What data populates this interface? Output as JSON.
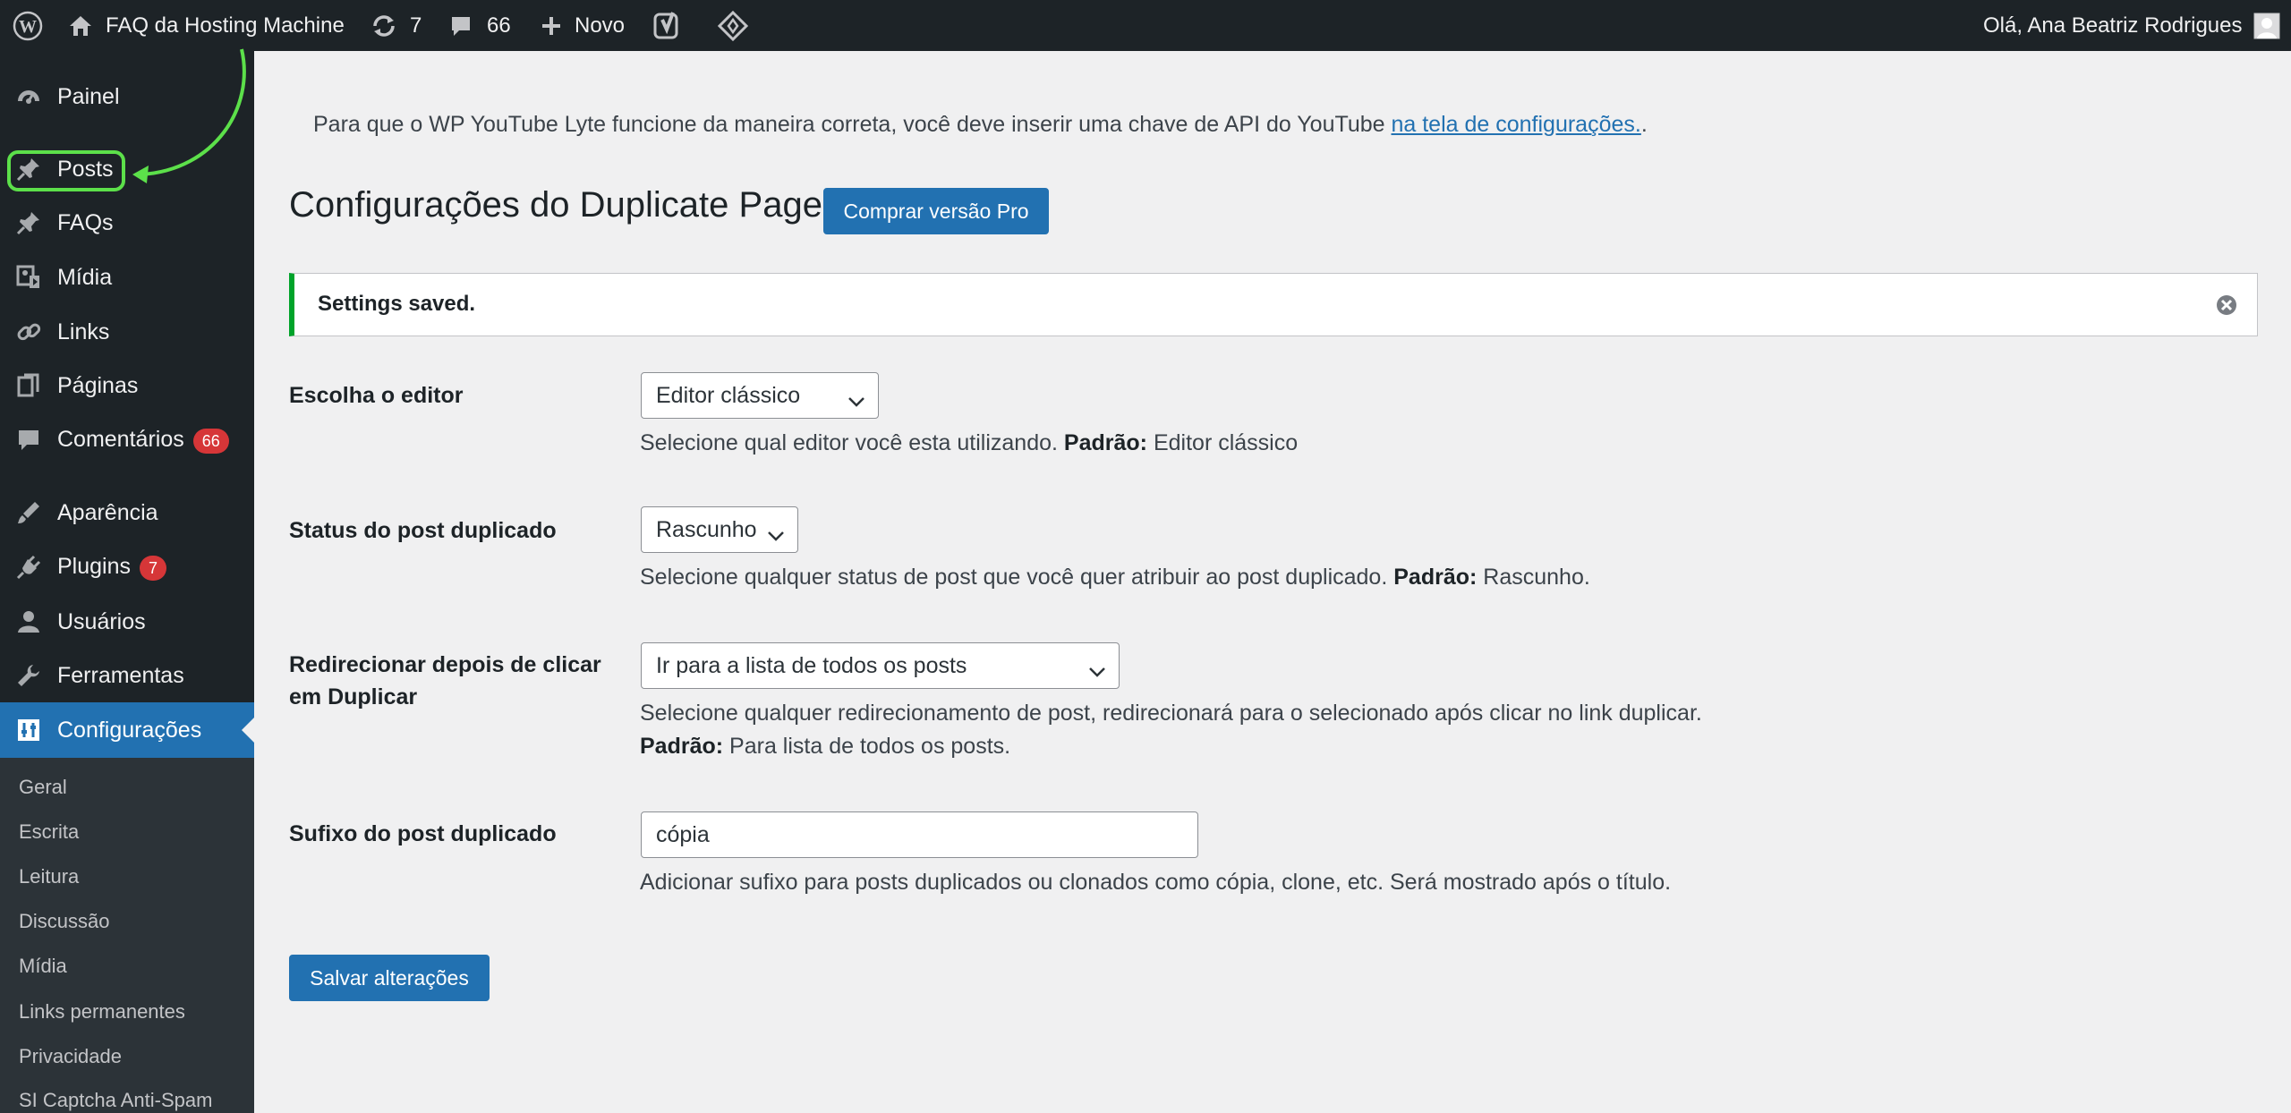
{
  "adminbar": {
    "site_name": "FAQ da Hosting Machine",
    "updates_count": "7",
    "comments_count": "66",
    "new_label": "Novo",
    "greeting": "Olá, Ana Beatriz Rodrigues"
  },
  "sidebar": {
    "items": [
      {
        "label": "Painel",
        "icon": "dashboard-icon"
      },
      {
        "label": "Posts",
        "icon": "pin-icon"
      },
      {
        "label": "FAQs",
        "icon": "pin-icon"
      },
      {
        "label": "Mídia",
        "icon": "media-icon"
      },
      {
        "label": "Links",
        "icon": "link-icon"
      },
      {
        "label": "Páginas",
        "icon": "pages-icon"
      },
      {
        "label": "Comentários",
        "icon": "comment-icon",
        "badge": "66"
      },
      {
        "label": "Aparência",
        "icon": "appearance-icon"
      },
      {
        "label": "Plugins",
        "icon": "plugin-icon",
        "badge": "7"
      },
      {
        "label": "Usuários",
        "icon": "user-icon"
      },
      {
        "label": "Ferramentas",
        "icon": "wrench-icon"
      },
      {
        "label": "Configurações",
        "icon": "settings-icon"
      }
    ],
    "submenu": [
      "Geral",
      "Escrita",
      "Leitura",
      "Discussão",
      "Mídia",
      "Links permanentes",
      "Privacidade",
      "SI Captcha Anti-Spam"
    ]
  },
  "main": {
    "lyte_notice_text": "Para que o WP YouTube Lyte funcione da maneira correta, você deve inserir uma chave de API do YouTube ",
    "lyte_notice_link": "na tela de configurações.",
    "lyte_notice_end": ".",
    "title": "Configurações do Duplicate Page",
    "pro_button": "Comprar versão Pro",
    "saved_notice": "Settings saved.",
    "fields": {
      "editor": {
        "label": "Escolha o editor",
        "value": "Editor clássico",
        "desc": "Selecione qual editor você esta utilizando. ",
        "default_label": "Padrão:",
        "default_value": " Editor clássico"
      },
      "status": {
        "label": "Status do post duplicado",
        "value": "Rascunho",
        "desc": "Selecione qualquer status de post que você quer atribuir ao post duplicado. ",
        "default_label": "Padrão:",
        "default_value": " Rascunho."
      },
      "redirect": {
        "label_line1": "Redirecionar depois de clicar",
        "label_line2": "em Duplicar",
        "value": "Ir para a lista de todos os posts",
        "desc": "Selecione qualquer redirecionamento de post, redirecionará para o selecionado após clicar no link duplicar.",
        "default_label": "Padrão:",
        "default_value": " Para lista de todos os posts."
      },
      "suffix": {
        "label": "Sufixo do post duplicado",
        "value": "cópia",
        "desc": "Adicionar sufixo para posts duplicados ou clonados como cópia, clone, etc. Será mostrado após o título."
      }
    },
    "save_button": "Salvar alterações"
  }
}
